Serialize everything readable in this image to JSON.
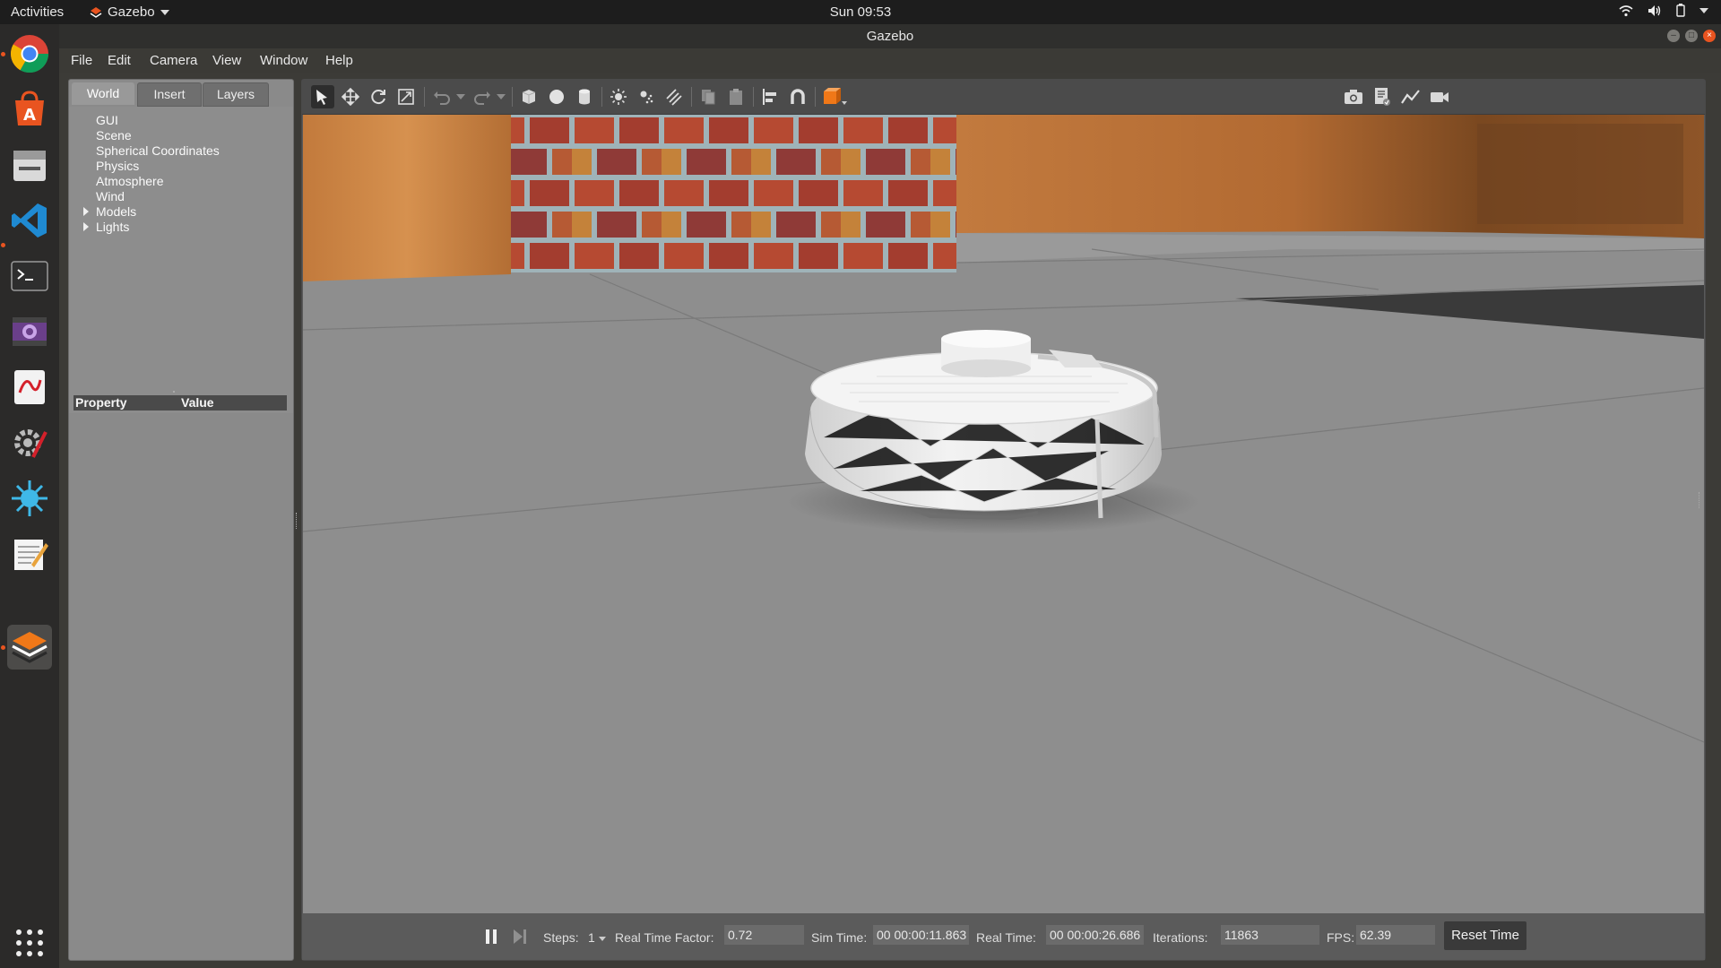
{
  "system_bar": {
    "activities": "Activities",
    "app_name": "Gazebo",
    "clock": "Sun 09:53"
  },
  "window": {
    "title": "Gazebo"
  },
  "menus": [
    "File",
    "Edit",
    "Camera",
    "View",
    "Window",
    "Help"
  ],
  "left_panel": {
    "tabs": [
      {
        "label": "World",
        "selected": true
      },
      {
        "label": "Insert",
        "selected": false
      },
      {
        "label": "Layers",
        "selected": false
      }
    ],
    "tree": [
      "GUI",
      "Scene",
      "Spherical Coordinates",
      "Physics",
      "Atmosphere",
      "Wind",
      "Models",
      "Lights"
    ],
    "property_header": {
      "property": "Property",
      "value": "Value"
    }
  },
  "dock": {
    "apps": [
      "chrome-icon",
      "software-center-icon",
      "file-manager-icon",
      "vscode-icon",
      "terminal-icon",
      "video-icon",
      "pdf-viewer-icon",
      "settings-tools-icon",
      "splash-icon",
      "text-editor-icon",
      "gazebo-icon"
    ],
    "running": [
      "chrome-icon",
      "terminal-icon",
      "gazebo-icon"
    ]
  },
  "toolbar": {
    "tools": [
      "select-mode",
      "translate-mode",
      "rotate-mode",
      "scale-mode",
      "undo",
      "redo",
      "box-shape",
      "sphere-shape",
      "cylinder-shape",
      "point-light",
      "spot-light",
      "directional-light",
      "copy",
      "paste",
      "align",
      "snap",
      "view-angle"
    ],
    "active_tool": "select-mode",
    "right_tools": [
      "screenshot",
      "log-data",
      "plot",
      "record-video"
    ]
  },
  "status": {
    "steps_label": "Steps:",
    "steps_value": "1",
    "rtf_label": "Real Time Factor:",
    "rtf_value": "0.72",
    "sim_time_label": "Sim Time:",
    "sim_time_value": "00 00:00:11.863",
    "real_time_label": "Real Time:",
    "real_time_value": "00 00:00:26.686",
    "iterations_label": "Iterations:",
    "iterations_value": "11863",
    "fps_label": "FPS:",
    "fps_value": "62.39",
    "reset_label": "Reset Time"
  },
  "colors": {
    "accent": "#e95420",
    "panel": "#8a8a8a",
    "floor": "#8c8c8c"
  }
}
